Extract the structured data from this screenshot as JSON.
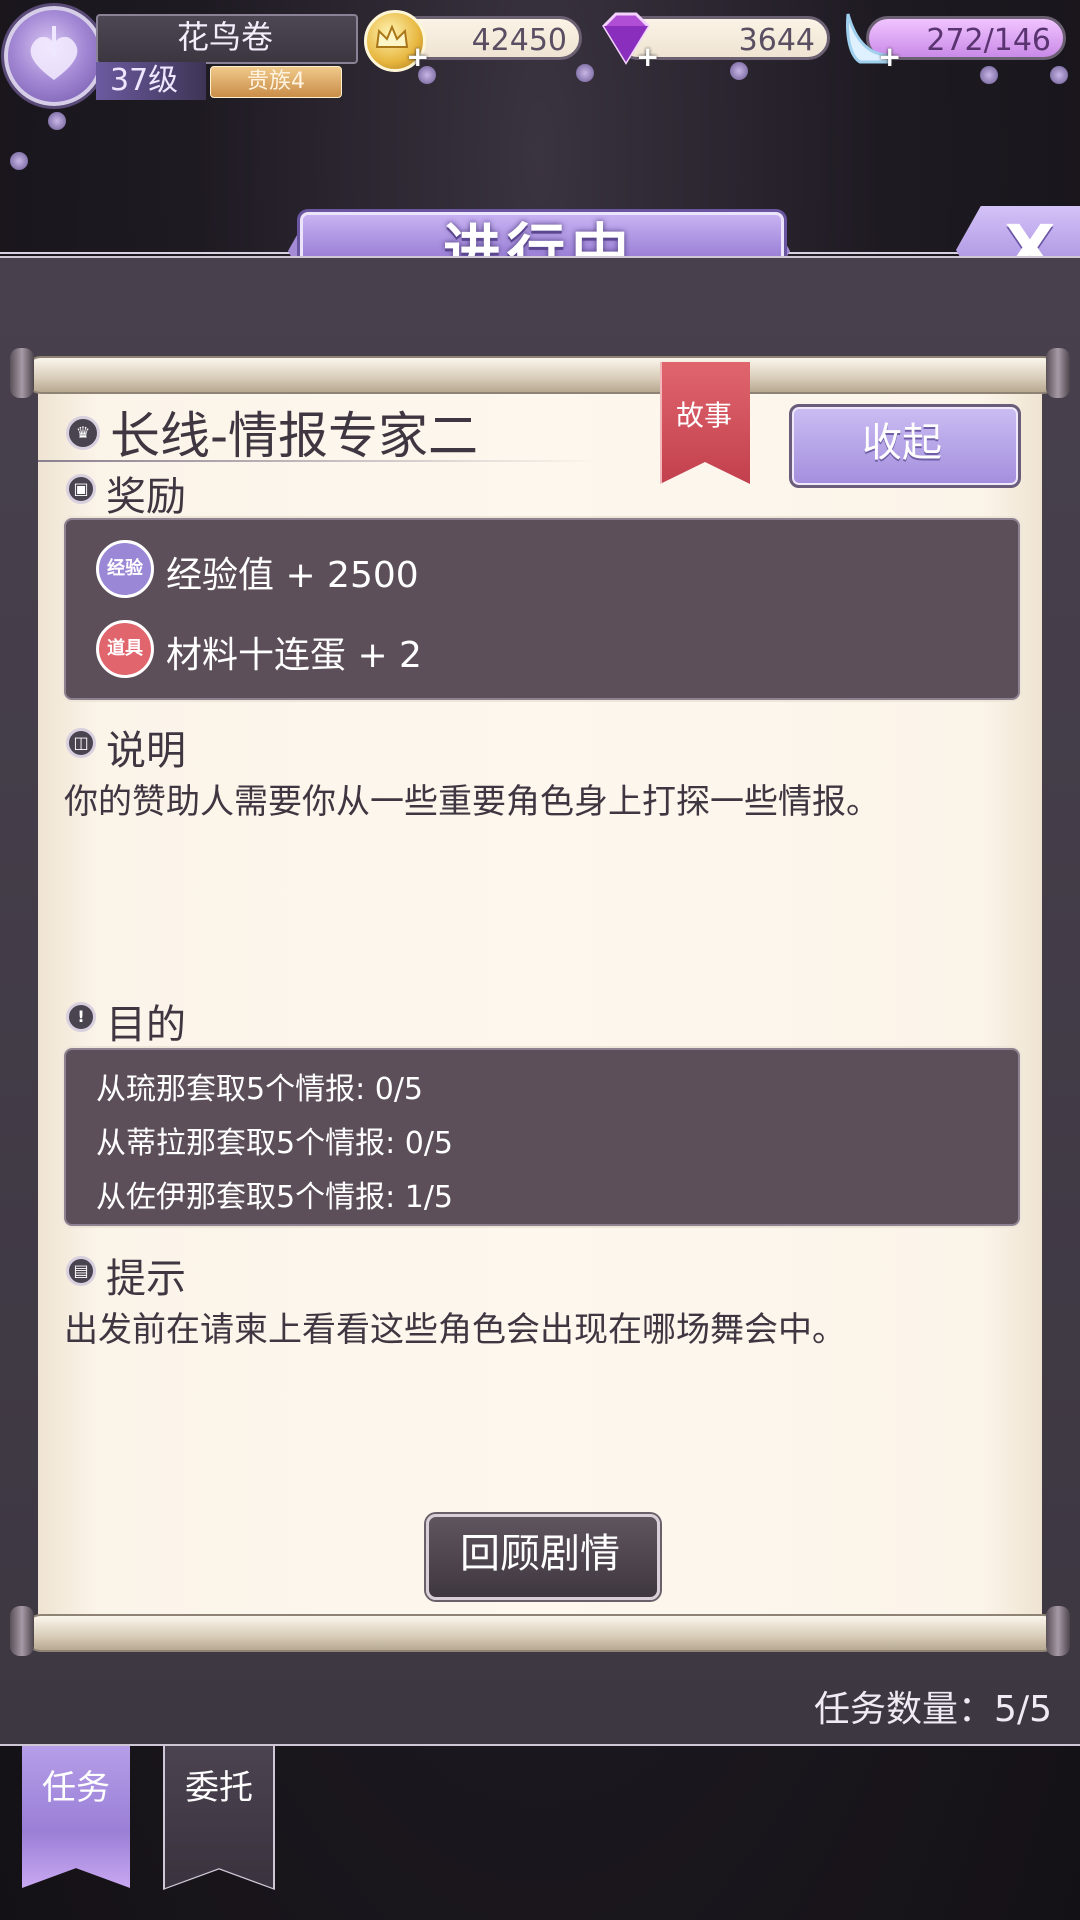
{
  "player": {
    "name": "花鸟卷",
    "level": "37级",
    "noble": "贵族4"
  },
  "resources": {
    "coins": "42450",
    "gems": "3644",
    "stamina": "272/146"
  },
  "header": {
    "title": "进行中",
    "close_label": "X"
  },
  "quest": {
    "title": "长线-情报专家二",
    "tag": "故事",
    "collapse_label": "收起",
    "reward_heading": "奖励",
    "rewards": [
      {
        "badge": "经验",
        "text": "经验值 + 2500",
        "color": "#9a87d6"
      },
      {
        "badge": "道具",
        "text": "材料十连蛋 + 2",
        "color": "#e0656d"
      }
    ],
    "description_heading": "说明",
    "description": "你的赞助人需要你从一些重要角色身上打探一些情报。",
    "goal_heading": "目的",
    "goals": [
      "从琉那套取5个情报: 0/5",
      "从蒂拉那套取5个情报: 0/5",
      "从佐伊那套取5个情报: 1/5"
    ],
    "hint_heading": "提示",
    "hint": "出发前在请柬上看看这些角色会出现在哪场舞会中。",
    "review_label": "回顾剧情"
  },
  "task_count": "任务数量：5/5",
  "tabs": [
    {
      "label": "任务",
      "active": true
    },
    {
      "label": "委托",
      "active": false
    }
  ],
  "colors": {
    "accent_purple": "#9a7fd6",
    "panel_dark": "#443d48",
    "paper": "#fbf4e9",
    "ribbon_red": "#c2404d"
  }
}
